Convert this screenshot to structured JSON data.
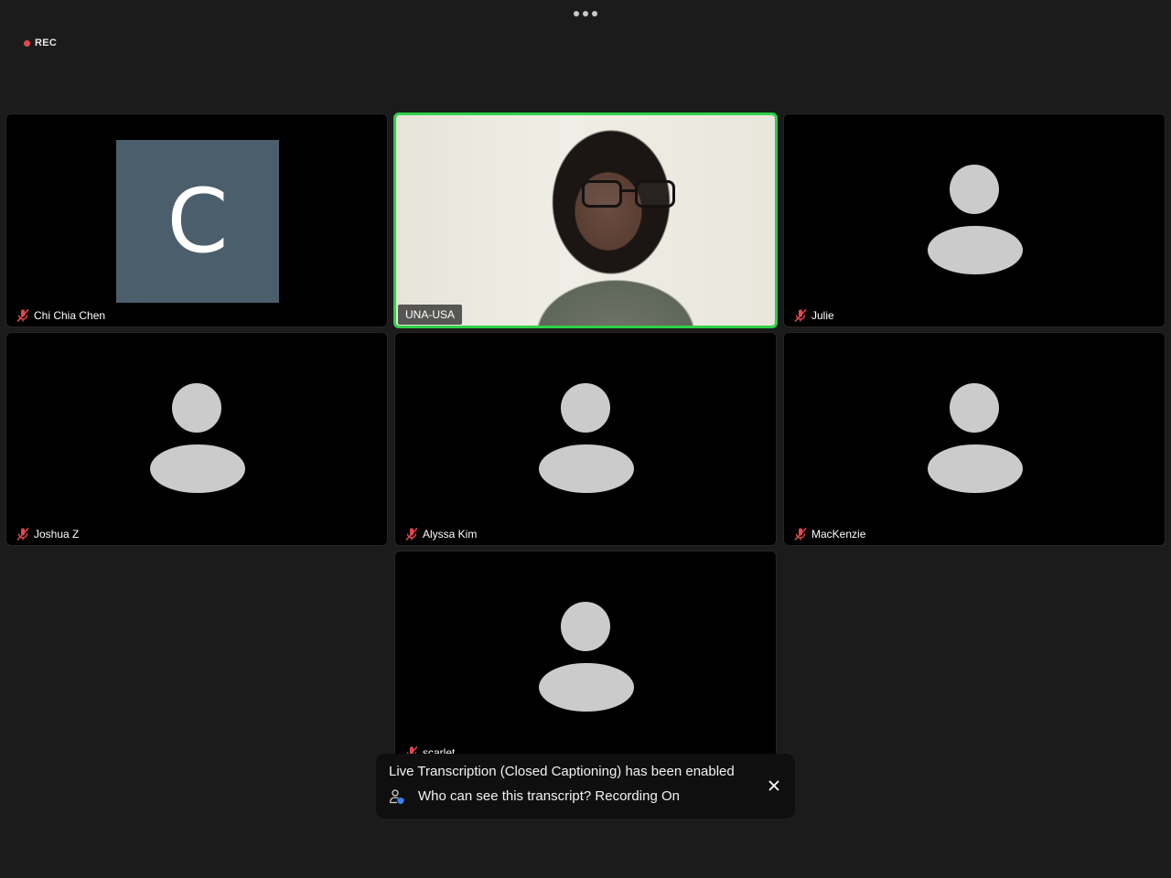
{
  "top_bar": {
    "more_icon": "more-horizontal-icon",
    "rec_label": "REC",
    "rec_color": "#e5484d"
  },
  "participants": [
    {
      "name": "Chi Chia Chen",
      "avatar": "C",
      "muted": true,
      "video_on": false
    },
    {
      "name": "UNA-USA",
      "muted": false,
      "video_on": true,
      "active_speaker": true
    },
    {
      "name": "Julie",
      "muted": true,
      "video_on": false
    },
    {
      "name": "Joshua Z",
      "muted": true,
      "video_on": false
    },
    {
      "name": "Alyssa Kim",
      "muted": true,
      "video_on": false
    },
    {
      "name": "MacKenzie",
      "muted": true,
      "video_on": false
    },
    {
      "name": "scarlet",
      "muted": true,
      "video_on": false
    }
  ],
  "toast": {
    "line1": "Live Transcription (Closed Captioning) has been enabled",
    "line2": "Who can see this transcript? Recording On",
    "close_icon": "close-icon"
  },
  "colors": {
    "background": "#1b1b1b",
    "tile": "#000000",
    "active_speaker_border": "#2ed146",
    "avatar_bg": "#4b5e6b",
    "muted_icon": "#e5484d"
  }
}
